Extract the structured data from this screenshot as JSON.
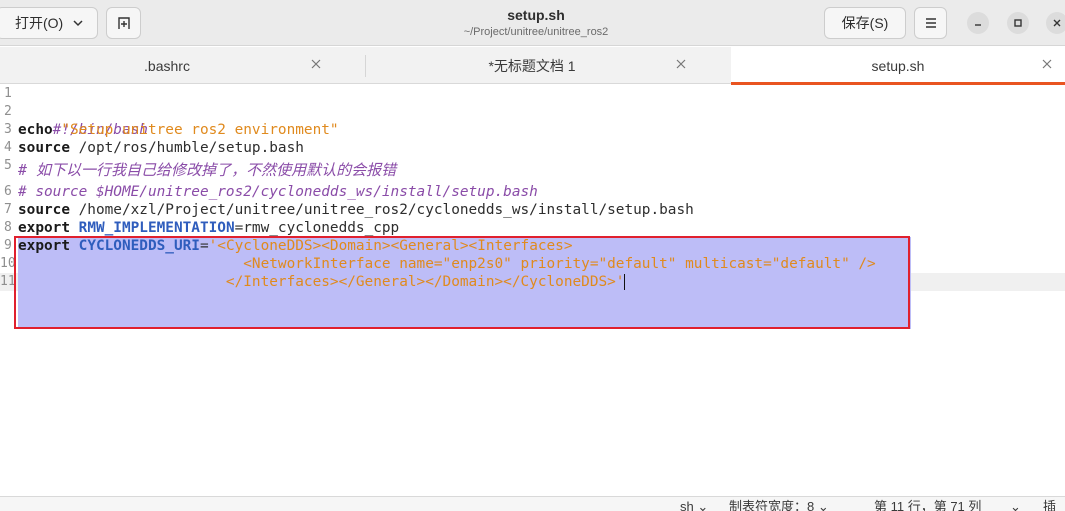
{
  "header": {
    "open_label": "打开(O)",
    "title": "setup.sh",
    "subtitle": "~/Project/unitree/unitree_ros2",
    "save_label": "保存(S)"
  },
  "tabs": [
    {
      "label": ".bashrc"
    },
    {
      "label": "*无标题文档 1"
    },
    {
      "label": "setup.sh",
      "active": true
    }
  ],
  "editor": {
    "line_numbers": [
      "1",
      "2",
      "3",
      "4",
      "5",
      "6",
      "7",
      "8",
      "9",
      "10",
      "11"
    ],
    "lines": {
      "l2": "#!/bin/bash",
      "l3_kw": "echo",
      "l3_str": "\"Setup unitree ros2 environment\"",
      "l4_kw": "source",
      "l4_rest": " /opt/ros/humble/setup.bash",
      "l5": "# 如下以一行我自己给修改掉了，不然使用默认的会报错",
      "l6": "# source $HOME/unitree_ros2/cyclonedds_ws/install/setup.bash",
      "l7_kw": "source",
      "l7_rest": " /home/xzl/Project/unitree/unitree_ros2/cyclonedds_ws/install/setup.bash",
      "l8_kw": "export",
      "l8_var": "RMW_IMPLEMENTATION",
      "l8_rest": "=rmw_cyclonedds_cpp",
      "l9_kw": "export",
      "l9_var": "CYCLONEDDS_URI",
      "l9_eq": "=",
      "l9_str": "'<CycloneDDS><Domain><General><Interfaces>",
      "l10_str": "                          <NetworkInterface name=\"enp2s0\" priority=\"default\" multicast=\"default\" />",
      "l11_str": "                        </Interfaces></General></Domain></CycloneDDS>'"
    }
  },
  "status": {
    "language": "sh ⌄",
    "tab_width": "制表符宽度：8 ⌄",
    "position": "第 11 行，第 71 列",
    "dropdown": "⌄",
    "insert_mode": "插"
  },
  "colors": {
    "accent": "#e95420",
    "selection": "#bdbdf7",
    "highlight_box": "#e0202e"
  }
}
